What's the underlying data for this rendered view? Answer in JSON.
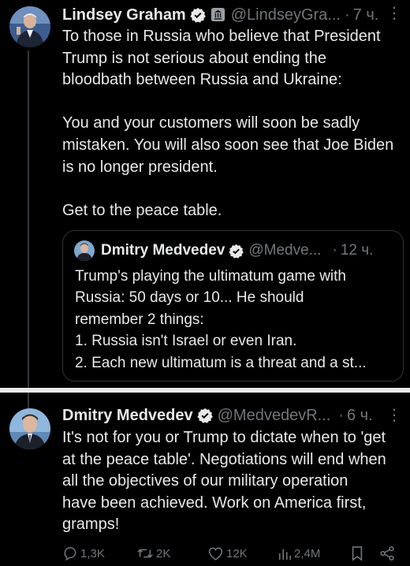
{
  "tweet1": {
    "name": "Lindsey Graham",
    "handle": "@LindseyGra...",
    "dot": "·",
    "time": "7 ч.",
    "more": "⋮",
    "text": [
      "To those in Russia who believe that President",
      "Trump is not serious about ending the",
      "bloodbath between Russia and Ukraine:",
      "",
      "You and your customers will soon be sadly",
      "mistaken. You will also soon see that Joe Biden",
      "is no longer president.",
      "",
      "Get to the peace table."
    ],
    "quote": {
      "name": "Dmitry Medvedev",
      "handle": "@Medve...",
      "dot": "·",
      "time": "12 ч.",
      "text": "Trump's playing the ultimatum game with\nRussia: 50 days or 10... He should\nremember 2 things:\n1. Russia isn't Israel or even Iran.\n2. Each new ultimatum is a threat and a st..."
    }
  },
  "tweet2": {
    "name": "Dmitry Medvedev",
    "handle": "@MedvedevR...",
    "dot": "·",
    "time": "6 ч.",
    "more": "⋮",
    "text": [
      "It's not for you or Trump to dictate when to 'get",
      "at the peace table'. Negotiations will end when",
      "all the objectives of our military operation",
      "have been achieved. Work on America first,",
      "gramps!"
    ],
    "actions": {
      "replies": "1,3K",
      "reposts": "2K",
      "likes": "12K",
      "views": "2,4M"
    }
  },
  "colors": {
    "background": "#000000",
    "text": "#e7e9ea",
    "muted": "#71767b",
    "verified": "#1d9bf0",
    "separator": "#e9e9e9"
  },
  "icons": [
    "verified-badge-icon",
    "government-building-icon",
    "more-icon",
    "reply-icon",
    "repost-icon",
    "like-icon",
    "views-icon",
    "bookmark-icon",
    "share-icon"
  ]
}
